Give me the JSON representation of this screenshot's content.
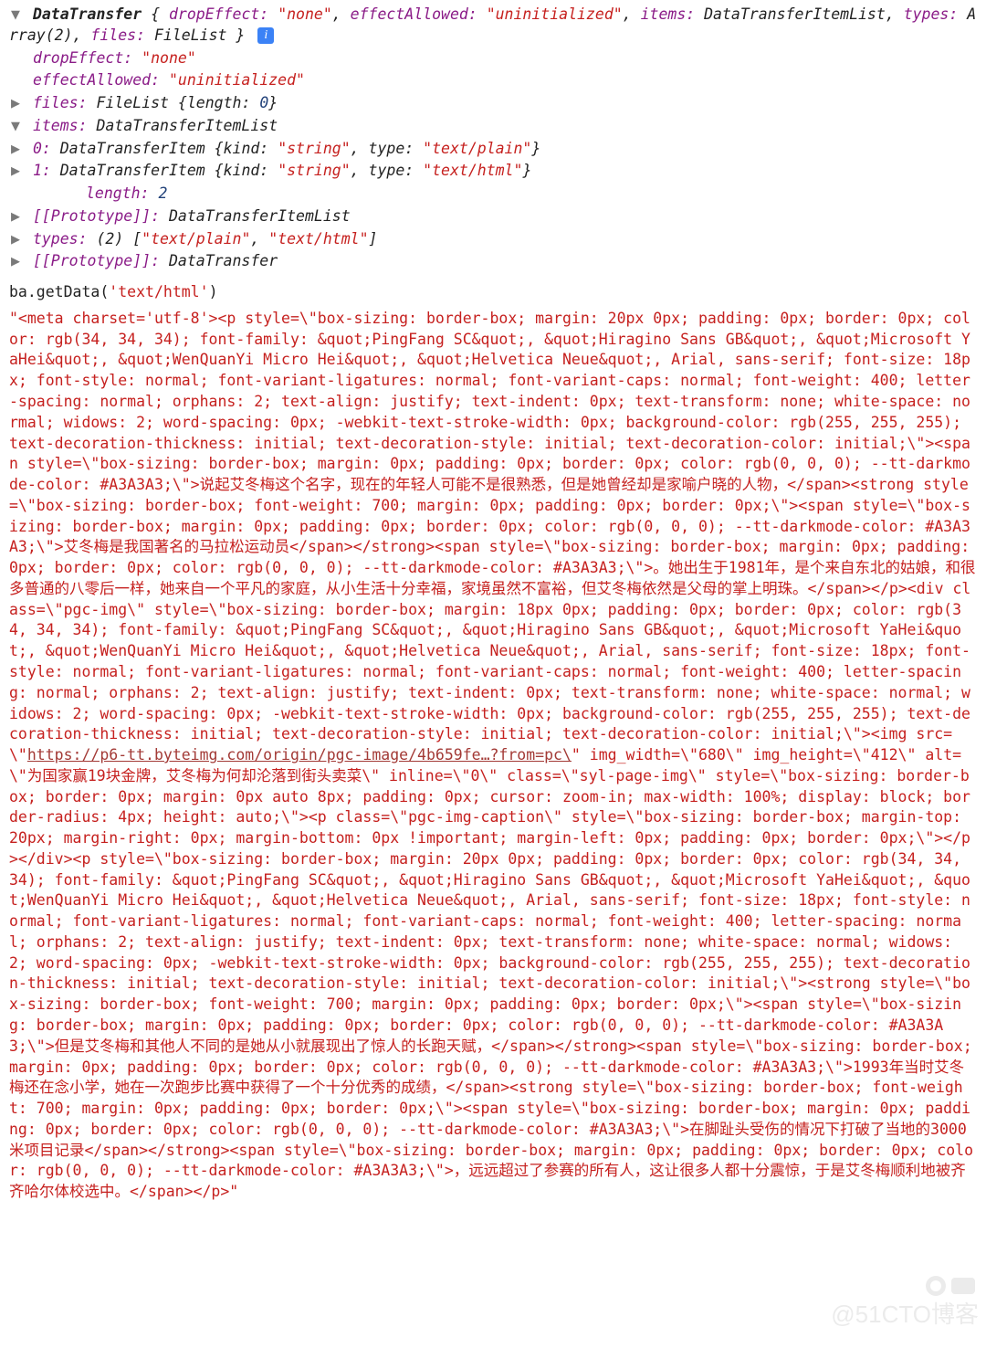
{
  "summary": {
    "class": "DataTransfer",
    "open_brace": "{",
    "kv1_key": "dropEffect:",
    "kv1_val": "\"none\"",
    "kv2_key": "effectAllowed:",
    "kv2_val": "\"uninitialized\"",
    "kv3_key": "items:",
    "kv3_val": "DataTransferItemList",
    "kv4_key": "types:",
    "kv4_val": "Array(2)",
    "kv5_key": "files:",
    "kv5_val": "FileList",
    "close_brace": "}"
  },
  "arrows": {
    "down": "▼",
    "right": "▶"
  },
  "info_badge": "i",
  "props": {
    "dropEffect": {
      "key": "dropEffect:",
      "val": "\"none\""
    },
    "effectAllowed": {
      "key": "effectAllowed:",
      "val": "\"uninitialized\""
    },
    "files": {
      "key": "files:",
      "class": "FileList",
      "len_key": "{length:",
      "len_val": "0",
      "close": "}"
    },
    "items": {
      "key": "items:",
      "class": "DataTransferItemList",
      "row0": {
        "idx": "0:",
        "class": "DataTransferItem",
        "kind_key": "{kind:",
        "kind_val": "\"string\"",
        "type_key": "type:",
        "type_val": "\"text/plain\"",
        "close": "}"
      },
      "row1": {
        "idx": "1:",
        "class": "DataTransferItem",
        "kind_key": "{kind:",
        "kind_val": "\"string\"",
        "type_key": "type:",
        "type_val": "\"text/html\"",
        "close": "}"
      },
      "length": {
        "key": "length:",
        "val": "2"
      },
      "proto": {
        "key": "[[Prototype]]:",
        "val": "DataTransferItemList"
      }
    },
    "types": {
      "key": "types:",
      "len": "(2)",
      "arr": "[\"text/plain\", \"text/html\"]",
      "arr_pre": "[",
      "v0": "\"text/plain\"",
      "sep": ", ",
      "v1": "\"text/html\"",
      "arr_post": "]"
    },
    "proto": {
      "key": "[[Prototype]]:",
      "val": "DataTransfer"
    }
  },
  "command": {
    "object": "ba",
    "method": ".getData(",
    "arg": "'text/html'",
    "close": ")"
  },
  "result": {
    "pre_link": "\"<meta charset='utf-8'><p style=\\\"box-sizing: border-box; margin: 20px 0px; padding: 0px; border: 0px; color: rgb(34, 34, 34); font-family: &quot;PingFang SC&quot;, &quot;Hiragino Sans GB&quot;, &quot;Microsoft YaHei&quot;, &quot;WenQuanYi Micro Hei&quot;, &quot;Helvetica Neue&quot;, Arial, sans-serif; font-size: 18px; font-style: normal; font-variant-ligatures: normal; font-variant-caps: normal; font-weight: 400; letter-spacing: normal; orphans: 2; text-align: justify; text-indent: 0px; text-transform: none; white-space: normal; widows: 2; word-spacing: 0px; -webkit-text-stroke-width: 0px; background-color: rgb(255, 255, 255); text-decoration-thickness: initial; text-decoration-style: initial; text-decoration-color: initial;\\\"><span style=\\\"box-sizing: border-box; margin: 0px; padding: 0px; border: 0px; color: rgb(0, 0, 0); --tt-darkmode-color: #A3A3A3;\\\">说起艾冬梅这个名字，现在的年轻人可能不是很熟悉，但是她曾经却是家喻户晓的人物，</span><strong style=\\\"box-sizing: border-box; font-weight: 700; margin: 0px; padding: 0px; border: 0px;\\\"><span style=\\\"box-sizing: border-box; margin: 0px; padding: 0px; border: 0px; color: rgb(0, 0, 0); --tt-darkmode-color: #A3A3A3;\\\">艾冬梅是我国著名的马拉松运动员</span></strong><span style=\\\"box-sizing: border-box; margin: 0px; padding: 0px; border: 0px; color: rgb(0, 0, 0); --tt-darkmode-color: #A3A3A3;\\\">。她出生于1981年，是个来自东北的姑娘，和很多普通的八零后一样，她来自一个平凡的家庭，从小生活十分幸福，家境虽然不富裕，但艾冬梅依然是父母的掌上明珠。</span></p><div class=\\\"pgc-img\\\" style=\\\"box-sizing: border-box; margin: 18px 0px; padding: 0px; border: 0px; color: rgb(34, 34, 34); font-family: &quot;PingFang SC&quot;, &quot;Hiragino Sans GB&quot;, &quot;Microsoft YaHei&quot;, &quot;WenQuanYi Micro Hei&quot;, &quot;Helvetica Neue&quot;, Arial, sans-serif; font-size: 18px; font-style: normal; font-variant-ligatures: normal; font-variant-caps: normal; font-weight: 400; letter-spacing: normal; orphans: 2; text-align: justify; text-indent: 0px; text-transform: none; white-space: normal; widows: 2; word-spacing: 0px; -webkit-text-stroke-width: 0px; background-color: rgb(255, 255, 255); text-decoration-thickness: initial; text-decoration-style: initial; text-decoration-color: initial;\\\"><img src=\\\"",
    "link": "https://p6-tt.byteimg.com/origin/pgc-image/4b659fe…?from=pc\\",
    "post_link": "\" img_width=\\\"680\\\" img_height=\\\"412\\\" alt=\\\"为国家赢19块金牌，艾冬梅为何却沦落到街头卖菜\\\" inline=\\\"0\\\" class=\\\"syl-page-img\\\" style=\\\"box-sizing: border-box; border: 0px; margin: 0px auto 8px; padding: 0px; cursor: zoom-in; max-width: 100%; display: block; border-radius: 4px; height: auto;\\\"><p class=\\\"pgc-img-caption\\\" style=\\\"box-sizing: border-box; margin-top: 20px; margin-right: 0px; margin-bottom: 0px !important; margin-left: 0px; padding: 0px; border: 0px;\\\"></p></div><p style=\\\"box-sizing: border-box; margin: 20px 0px; padding: 0px; border: 0px; color: rgb(34, 34, 34); font-family: &quot;PingFang SC&quot;, &quot;Hiragino Sans GB&quot;, &quot;Microsoft YaHei&quot;, &quot;WenQuanYi Micro Hei&quot;, &quot;Helvetica Neue&quot;, Arial, sans-serif; font-size: 18px; font-style: normal; font-variant-ligatures: normal; font-variant-caps: normal; font-weight: 400; letter-spacing: normal; orphans: 2; text-align: justify; text-indent: 0px; text-transform: none; white-space: normal; widows: 2; word-spacing: 0px; -webkit-text-stroke-width: 0px; background-color: rgb(255, 255, 255); text-decoration-thickness: initial; text-decoration-style: initial; text-decoration-color: initial;\\\"><strong style=\\\"box-sizing: border-box; font-weight: 700; margin: 0px; padding: 0px; border: 0px;\\\"><span style=\\\"box-sizing: border-box; margin: 0px; padding: 0px; border: 0px; color: rgb(0, 0, 0); --tt-darkmode-color: #A3A3A3;\\\">但是艾冬梅和其他人不同的是她从小就展现出了惊人的长跑天赋，</span></strong><span style=\\\"box-sizing: border-box; margin: 0px; padding: 0px; border: 0px; color: rgb(0, 0, 0); --tt-darkmode-color: #A3A3A3;\\\">1993年当时艾冬梅还在念小学，她在一次跑步比赛中获得了一个十分优秀的成绩，</span><strong style=\\\"box-sizing: border-box; font-weight: 700; margin: 0px; padding: 0px; border: 0px;\\\"><span style=\\\"box-sizing: border-box; margin: 0px; padding: 0px; border: 0px; color: rgb(0, 0, 0); --tt-darkmode-color: #A3A3A3;\\\">在脚趾头受伤的情况下打破了当地的3000米项目记录</span></strong><span style=\\\"box-sizing: border-box; margin: 0px; padding: 0px; border: 0px; color: rgb(0, 0, 0); --tt-darkmode-color: #A3A3A3;\\\">，远远超过了参赛的所有人，这让很多人都十分震惊，于是艾冬梅顺利地被齐齐哈尔体校选中。</span></p>\""
  },
  "watermark": "@51CTO博客"
}
